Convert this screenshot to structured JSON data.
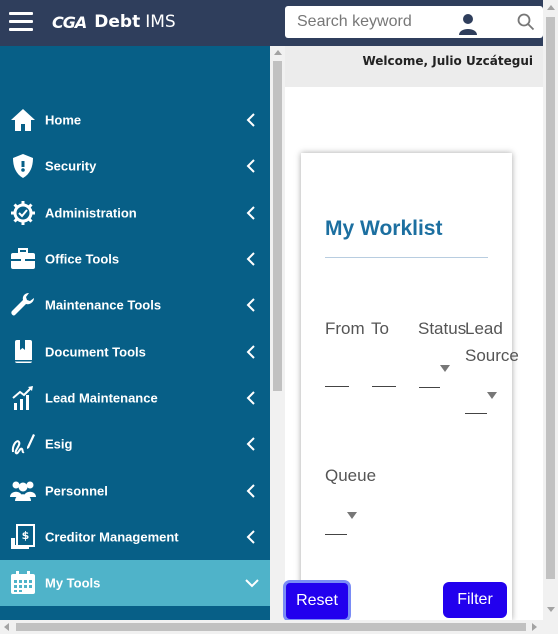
{
  "header": {
    "logo_mark": "CGA",
    "brand": "Debt",
    "brand_sub": "IMS",
    "search_placeholder": "Search keyword"
  },
  "welcome": "Welcome, Julio Uzcátegui",
  "sidebar": {
    "items": [
      {
        "label": "Home",
        "icon": "home-icon"
      },
      {
        "label": "Security",
        "icon": "shield-icon"
      },
      {
        "label": "Administration",
        "icon": "gear-check-icon"
      },
      {
        "label": "Office Tools",
        "icon": "toolbox-icon"
      },
      {
        "label": "Maintenance Tools",
        "icon": "wrench-icon"
      },
      {
        "label": "Document Tools",
        "icon": "bookmark-book-icon"
      },
      {
        "label": "Lead Maintenance",
        "icon": "growth-chart-icon"
      },
      {
        "label": "Esig",
        "icon": "signature-icon"
      },
      {
        "label": "Personnel",
        "icon": "people-icon"
      },
      {
        "label": "Creditor Management",
        "icon": "document-dollar-icon"
      },
      {
        "label": "My Tools",
        "icon": "calendar-icon",
        "active": true
      }
    ]
  },
  "worklist": {
    "title": "My Worklist",
    "from_label": "From",
    "to_label": "To",
    "status_label": "Status",
    "lead_source_label_line1": "Lead",
    "lead_source_label_line2": "Source",
    "queue_label": "Queue",
    "reset_label": "Reset",
    "filter_label": "Filter"
  },
  "colors": {
    "topbar": "#2f3e5c",
    "sidebar": "#075f87",
    "sidebar_active": "#4fb3c9",
    "title": "#1c6fa0",
    "button": "#2200ee"
  }
}
